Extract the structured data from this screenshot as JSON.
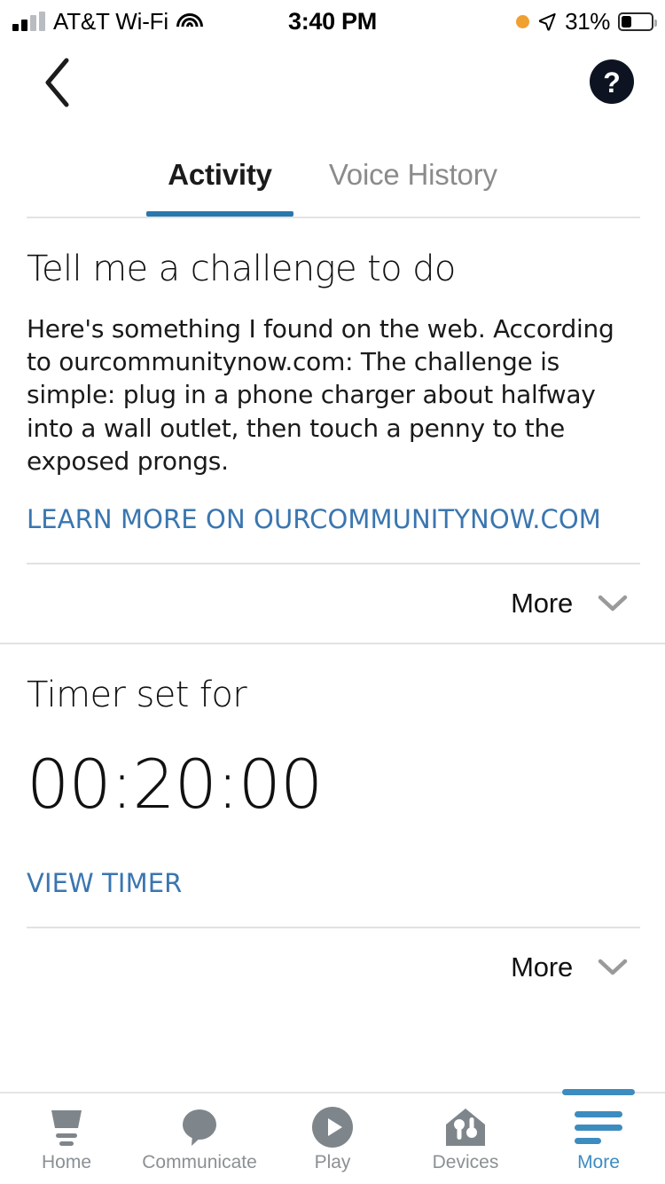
{
  "status_bar": {
    "carrier": "AT&T Wi-Fi",
    "time": "3:40 PM",
    "battery_percent": "31%",
    "signal_icon": "cellular-signal-icon",
    "wifi_icon": "wifi-icon",
    "location_icon": "location-arrow-icon",
    "battery_icon": "battery-icon",
    "recording_dot_icon": "orange-status-dot-icon",
    "battery_level": 31
  },
  "navbar": {
    "back_icon": "back-chevron-icon",
    "help_icon": "help-question-mark-icon"
  },
  "tabs": {
    "items": [
      {
        "label": "Activity",
        "active": true
      },
      {
        "label": "Voice History",
        "active": false
      }
    ]
  },
  "cards": [
    {
      "title": "Tell me a challenge to do",
      "body": "Here's something I found on the web. According to ourcommunitynow.com: The challenge is simple: plug in a phone charger about halfway into a wall outlet, then touch a penny to the exposed prongs.",
      "link": "LEARN MORE ON OURCOMMUNITYNOW.COM",
      "more_label": "More",
      "more_icon": "chevron-down-icon"
    },
    {
      "title": "Timer set for",
      "value": "00:20:00",
      "link": "VIEW TIMER",
      "more_label": "More",
      "more_icon": "chevron-down-icon"
    }
  ],
  "tabbar": {
    "items": [
      {
        "label": "Home",
        "icon": "echo-device-icon",
        "active": false
      },
      {
        "label": "Communicate",
        "icon": "speech-bubble-icon",
        "active": false
      },
      {
        "label": "Play",
        "icon": "play-circle-icon",
        "active": false
      },
      {
        "label": "Devices",
        "icon": "house-devices-icon",
        "active": false
      },
      {
        "label": "More",
        "icon": "hamburger-menu-icon",
        "active": true
      }
    ]
  },
  "colors": {
    "accent_blue": "#2a77ad",
    "link_blue": "#3a76b0",
    "tabbar_active": "#3d8cc0",
    "inactive_gray": "#8b9094",
    "divider": "#e2e2e2",
    "status_orange": "#f0a030"
  }
}
